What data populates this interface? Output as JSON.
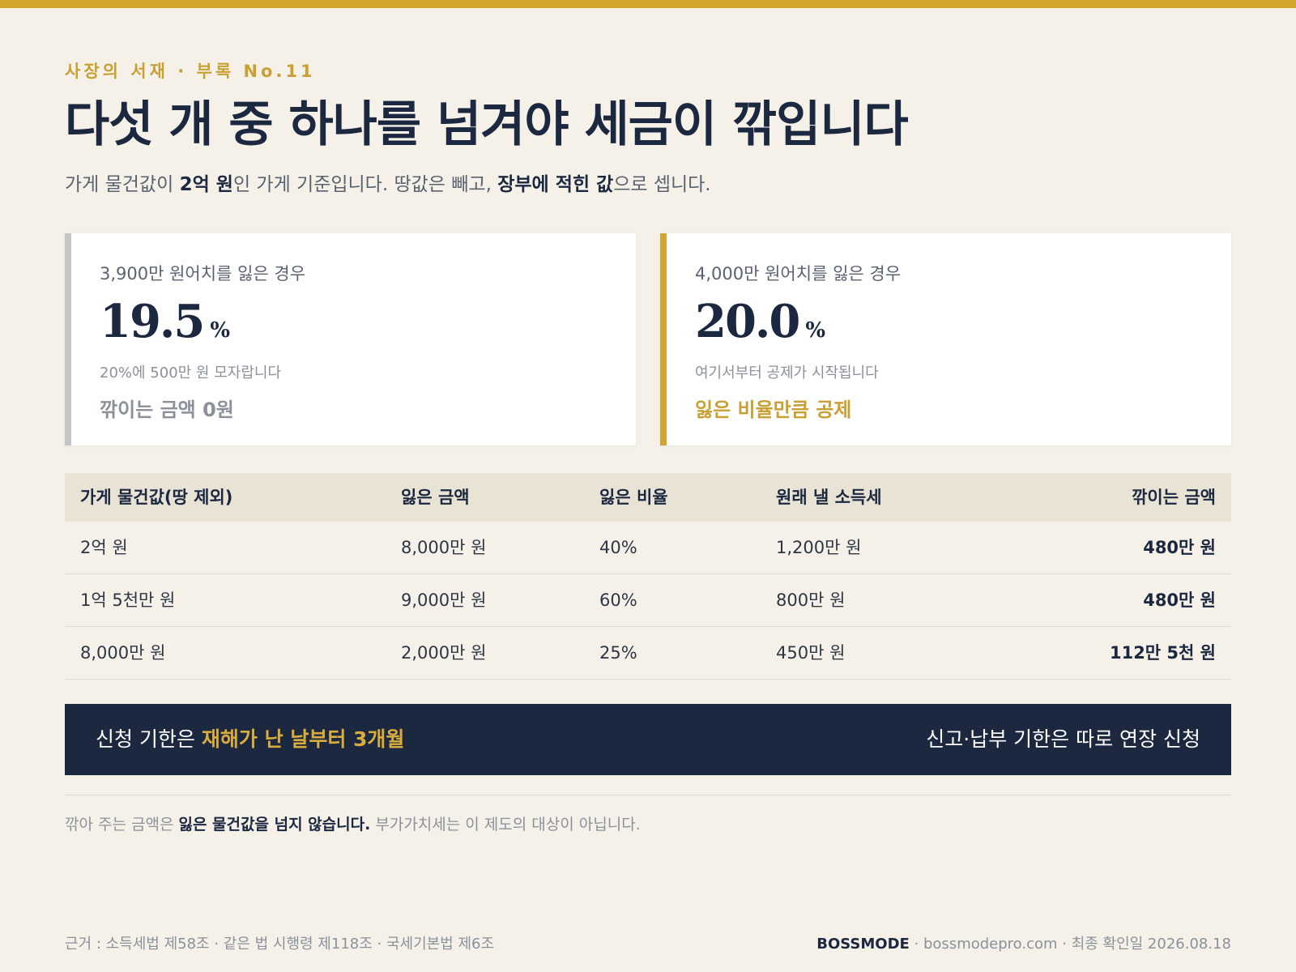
{
  "header": {
    "eyebrow": "사장의 서재 · 부록 No.11",
    "title": "다섯 개 중 하나를 넘겨야 세금이 깎입니다",
    "subtitle": {
      "t1": "가게 물건값이 ",
      "b1": "2억 원",
      "t2": "인 가게 기준입니다. 땅값은 빼고, ",
      "b2": "장부에 적힌 값",
      "t3": "으로 셉니다."
    }
  },
  "cards": [
    {
      "label": "3,900만 원어치를 잃은 경우",
      "value": "19.5",
      "unit": "%",
      "note": "20%에 500만 원 모자랍니다",
      "result": "깎이는 금액 0원"
    },
    {
      "label": "4,000만 원어치를 잃은 경우",
      "value": "20.0",
      "unit": "%",
      "note": "여기서부터 공제가 시작됩니다",
      "result": "잃은 비율만큼 공제"
    }
  ],
  "table": {
    "headers": [
      "가게 물건값(땅 제외)",
      "잃은 금액",
      "잃은 비율",
      "원래 낼 소득세",
      "깎이는 금액"
    ],
    "rows": [
      [
        "2억 원",
        "8,000만 원",
        "40%",
        "1,200만 원",
        "480만 원"
      ],
      [
        "1억 5천만 원",
        "9,000만 원",
        "60%",
        "800만 원",
        "480만 원"
      ],
      [
        "8,000만 원",
        "2,000만 원",
        "25%",
        "450만 원",
        "112만 5천 원"
      ]
    ]
  },
  "banner": {
    "left_prefix": "신청 기한은 ",
    "left_highlight": "재해가 난 날부터 3개월",
    "right": "신고·납부 기한은 따로 연장 신청"
  },
  "footnote": {
    "t1": "깎아 주는 금액은 ",
    "b1": "잃은 물건값을 넘지 않습니다.",
    "t2": " 부가가치세는 이 제도의 대상이 아닙니다."
  },
  "footer": {
    "sources": "근거 : 소득세법 제58조 · 같은 법 시행령 제118조 · 국세기본법 제6조",
    "brand": "BOSSMODE",
    "site": " · bossmodepro.com · 최종 확인일 2026.08.18"
  },
  "colors": {
    "navy": "#1b2840",
    "gold": "#d2a62e",
    "background": "#f5f1e9",
    "muted": "#8b919a"
  }
}
